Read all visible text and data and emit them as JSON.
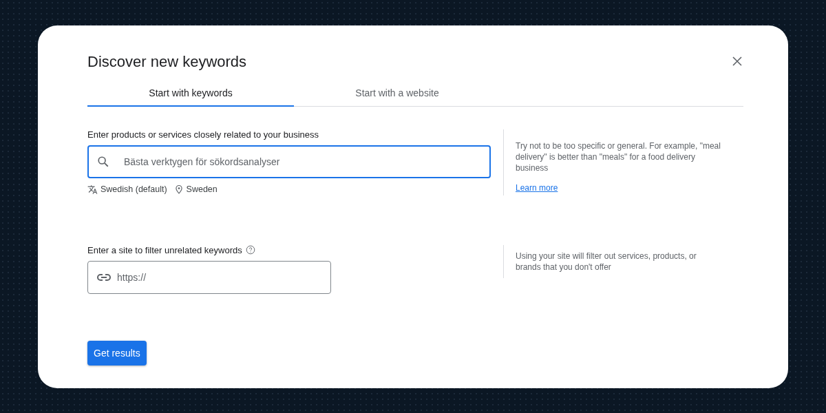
{
  "dialog": {
    "title": "Discover new keywords"
  },
  "tabs": [
    {
      "label": "Start with keywords",
      "selected": true
    },
    {
      "label": "Start with a website",
      "selected": false
    }
  ],
  "keywords": {
    "label": "Enter products or services closely related to your business",
    "value": "Bästa verktygen för sökordsanalyser",
    "language": "Swedish (default)",
    "location": "Sweden",
    "hint": "Try not to be too specific or general. For example, \"meal delivery\" is better than \"meals\" for a food delivery business",
    "link": "Learn more"
  },
  "site": {
    "label": "Enter a site to filter unrelated keywords",
    "placeholder": "https://",
    "hint": "Using your site will filter out services, products, or brands that you don't offer"
  },
  "buttons": [
    "Get results"
  ]
}
